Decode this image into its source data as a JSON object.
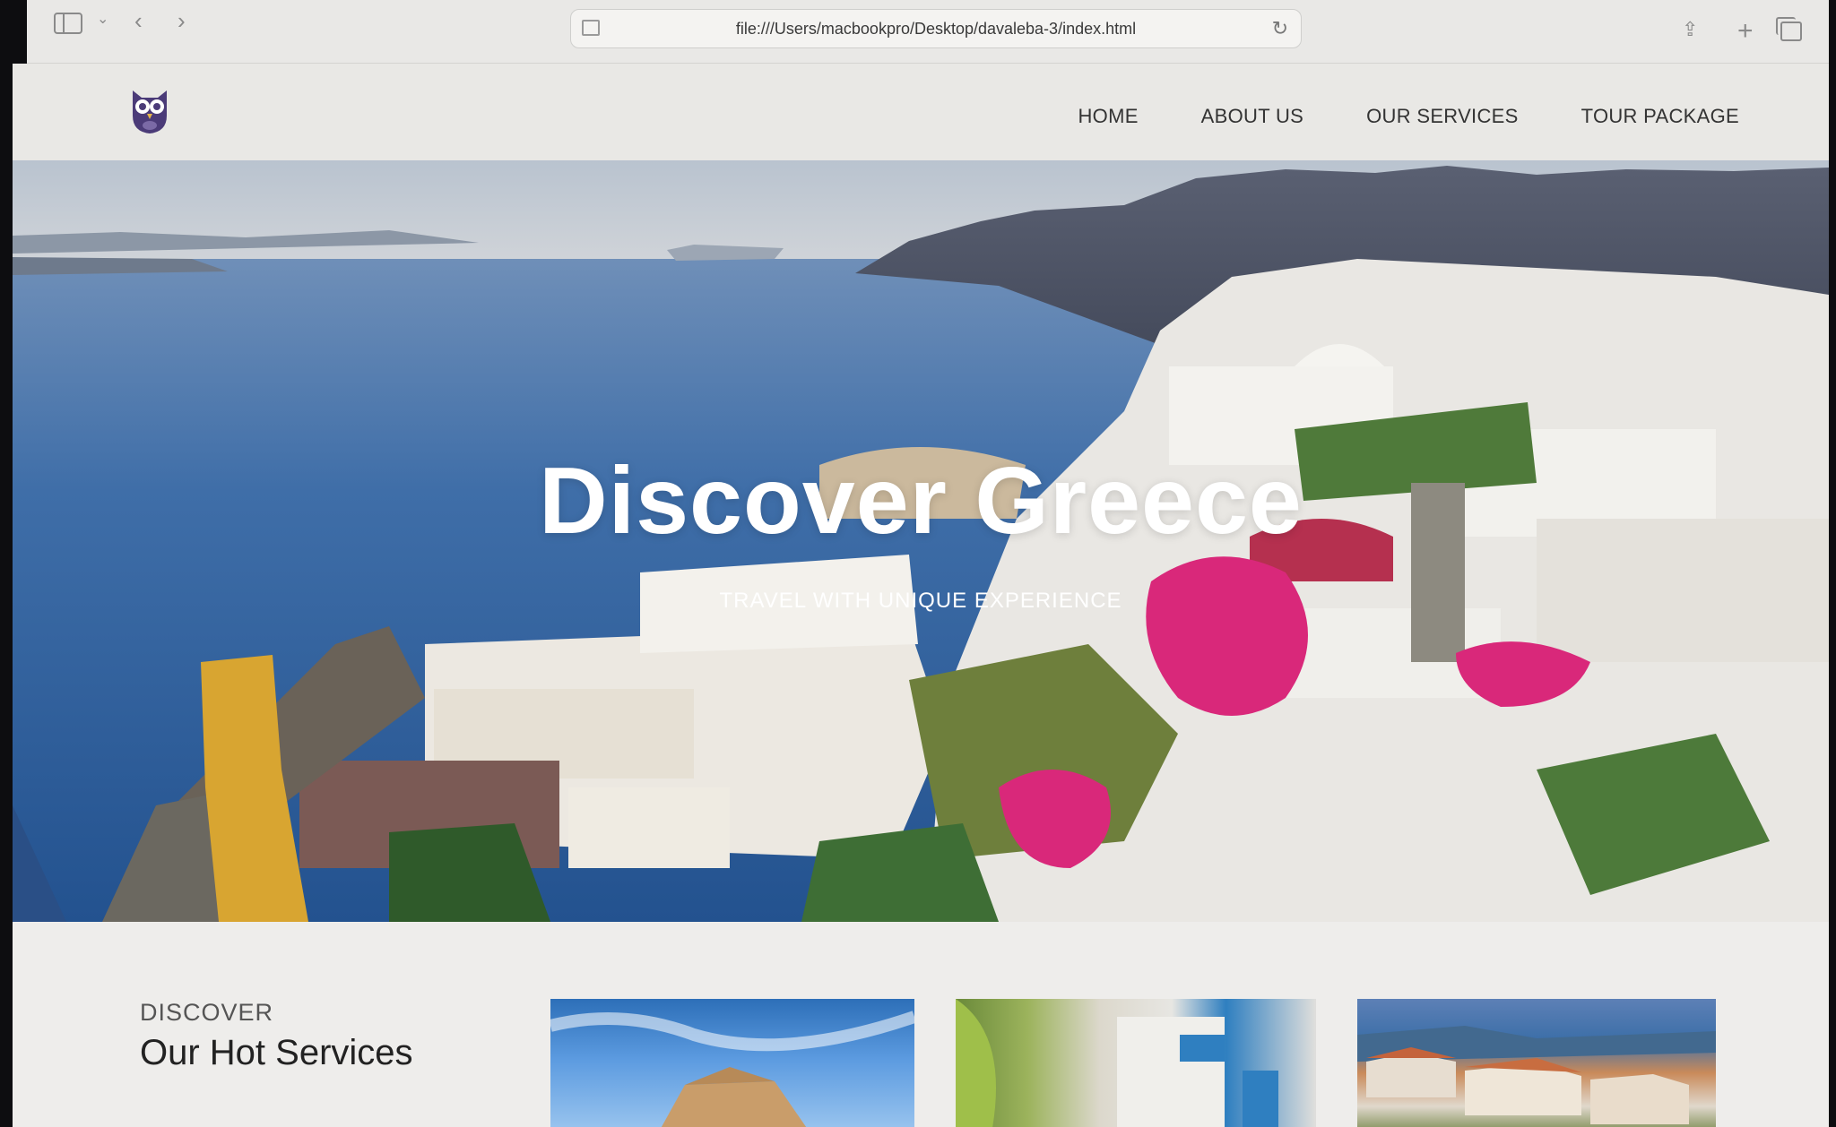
{
  "browser": {
    "url": "file:///Users/macbookpro/Desktop/davaleba-3/index.html"
  },
  "nav": {
    "items": [
      "HOME",
      "ABOUT US",
      "OUR SERVICES",
      "TOUR PACKAGE"
    ]
  },
  "hero": {
    "title": "Discover Greece",
    "subtitle": "TRAVEL WITH UNIQUE EXPERIENCE"
  },
  "services": {
    "kicker": "DISCOVER",
    "title": "Our Hot Services"
  },
  "colors": {
    "logo": "#4b3b78",
    "sea": "#2f5fa0",
    "accent_flowers": "#d9287a"
  }
}
